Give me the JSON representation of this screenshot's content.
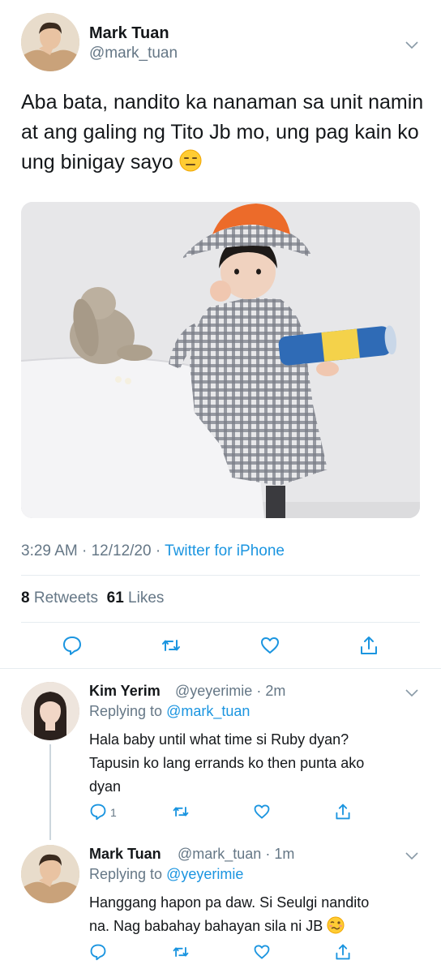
{
  "main_tweet": {
    "author_name": "Mark Tuan",
    "author_handle": "@mark_tuan",
    "text": "Aba bata, nandito ka nanaman sa unit namin at ang galing ng Tito Jb mo, ung pag kain ko ung binigay sayo",
    "emoji": "expressionless-face",
    "time": "3:29 AM",
    "date": "12/12/20",
    "source": "Twitter for iPhone",
    "retweets_count": "8",
    "retweets_label": "Retweets",
    "likes_count": "61",
    "likes_label": "Likes"
  },
  "replies": [
    {
      "author_name": "Kim Yerim",
      "author_handle": "@yeyerimie",
      "age": "2m",
      "replying_label": "Replying to",
      "replying_to": "@mark_tuan",
      "line1": "Hala baby until what time si Ruby dyan?",
      "line2": "Tapusin ko lang errands ko then punta ako",
      "line3": "dyan",
      "reply_count": "1"
    },
    {
      "author_name": "Mark Tuan",
      "author_handle": "@mark_tuan",
      "age": "1m",
      "replying_label": "Replying to",
      "replying_to": "@yeyerimie",
      "line1": "Hanggang hapon pa daw. Si Seulgi nandito",
      "line2": "na. Nag babahay bahayan sila ni JB",
      "emoji": "woozy-face"
    }
  ],
  "colors": {
    "accent": "#1b95e0",
    "secondary_text": "#657786",
    "divider": "#e6ecf0"
  }
}
